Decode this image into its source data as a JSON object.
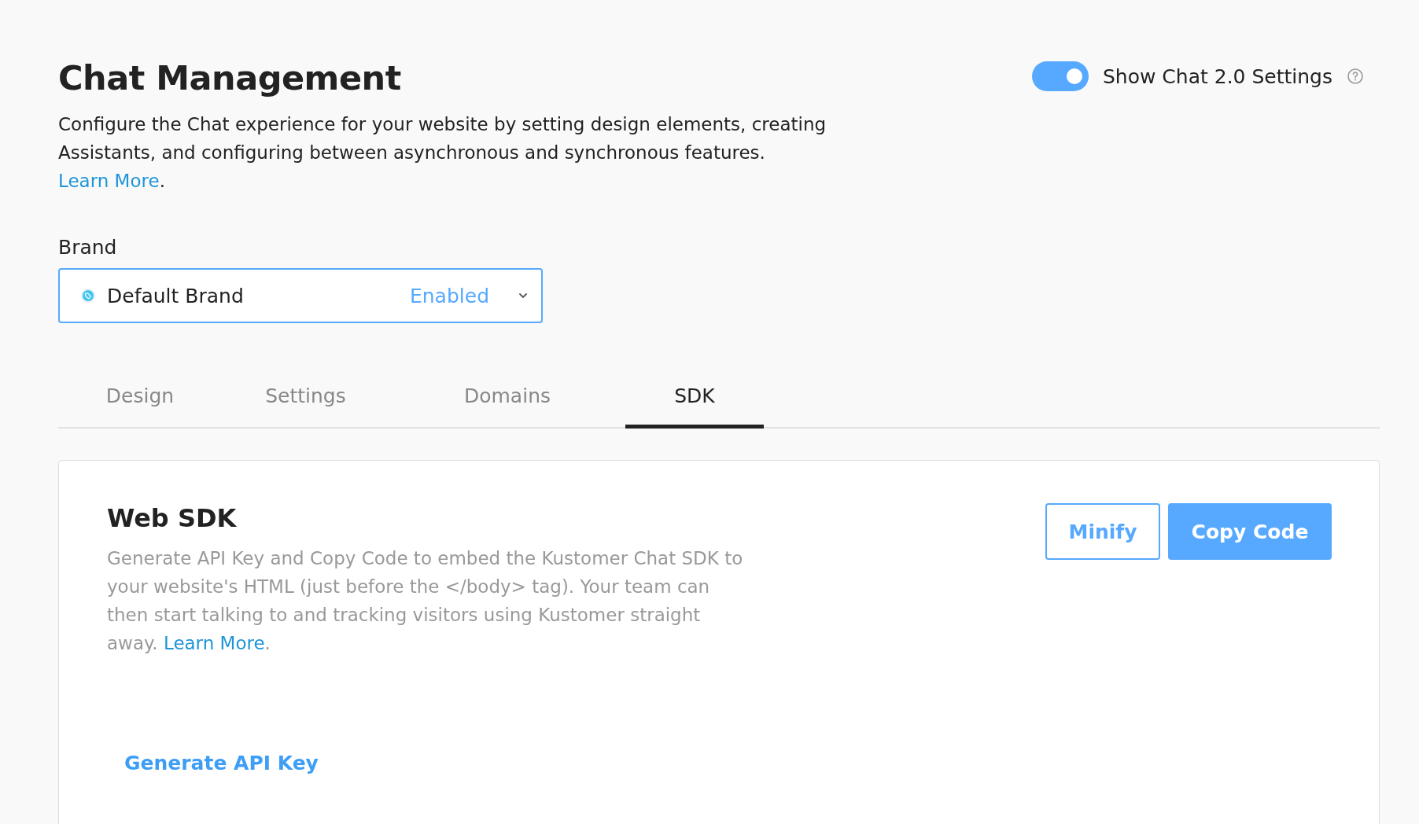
{
  "page": {
    "title": "Chat Management",
    "description": "Configure the Chat experience for your website by setting design elements, creating Assistants, and configuring between asynchronous and synchronous features.",
    "description_link": "Learn More",
    "description_end": "."
  },
  "chat2_toggle": {
    "label": "Show Chat 2.0 Settings",
    "on": true
  },
  "brand": {
    "label": "Brand",
    "value": "Default Brand",
    "status": "Enabled"
  },
  "tabs": [
    {
      "label": "Design",
      "selected": false
    },
    {
      "label": "Settings",
      "selected": false
    },
    {
      "label": "Domains",
      "selected": false
    },
    {
      "label": "SDK",
      "selected": true
    }
  ],
  "web_sdk": {
    "title": "Web SDK",
    "description": "Generate API Key and Copy Code to embed the Kustomer Chat SDK to your website's HTML (just before the </body> tag). Your team can then start talking to and tracking visitors using Kustomer straight away.",
    "description_link": "Learn More",
    "description_end": ".",
    "buttons": [
      {
        "label": "Minify",
        "kind": "outline"
      },
      {
        "label": "Copy Code",
        "kind": "primary"
      }
    ],
    "generate_link": "Generate API Key"
  }
}
